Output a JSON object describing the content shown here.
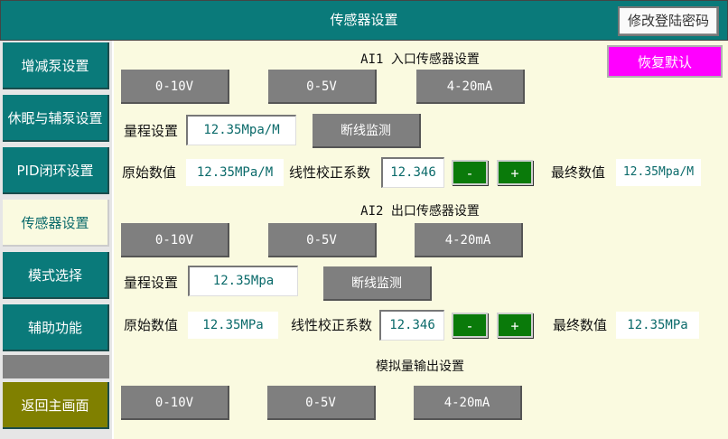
{
  "header": {
    "title": "传感器设置",
    "change_password_label": "修改登陆密码"
  },
  "sidebar": {
    "items": [
      {
        "label": "增减泵设置"
      },
      {
        "label": "休眠与辅泵设置"
      },
      {
        "label": "PID闭环设置"
      },
      {
        "label": "传感器设置"
      },
      {
        "label": "模式选择"
      },
      {
        "label": "辅助功能"
      }
    ],
    "home_label": "返回主画面"
  },
  "restore_default_label": "恢复默认",
  "ai1": {
    "title": "AI1 入口传感器设置",
    "signal_options": [
      "0-10V",
      "0-5V",
      "4-20mA"
    ],
    "range_label": "量程设置",
    "range_value": "12.35Mpa/M",
    "disconnect_label": "断线监测",
    "raw_label": "原始数值",
    "raw_value": "12.35MPa/M",
    "coef_label": "线性校正系数",
    "coef_value": "12.346",
    "minus_label": "-",
    "plus_label": "+",
    "final_label": "最终数值",
    "final_value": "12.35Mpa/M"
  },
  "ai2": {
    "title": "AI2 出口传感器设置",
    "signal_options": [
      "0-10V",
      "0-5V",
      "4-20mA"
    ],
    "range_label": "量程设置",
    "range_value": "12.35Mpa",
    "disconnect_label": "断线监测",
    "raw_label": "原始数值",
    "raw_value": "12.35MPa",
    "coef_label": "线性校正系数",
    "coef_value": "12.346",
    "minus_label": "-",
    "plus_label": "+",
    "final_label": "最终数值",
    "final_value": "12.35MPa"
  },
  "analog_output": {
    "title": "模拟量输出设置",
    "signal_options": [
      "0-10V",
      "0-5V",
      "4-20mA"
    ]
  },
  "colors": {
    "teal": "#0a7a7a",
    "panel": "#fafae0",
    "gray_button": "#7f7f7f",
    "green_button": "#0a7a0a",
    "magenta_button": "#ff00ff",
    "home_button": "#808000"
  }
}
